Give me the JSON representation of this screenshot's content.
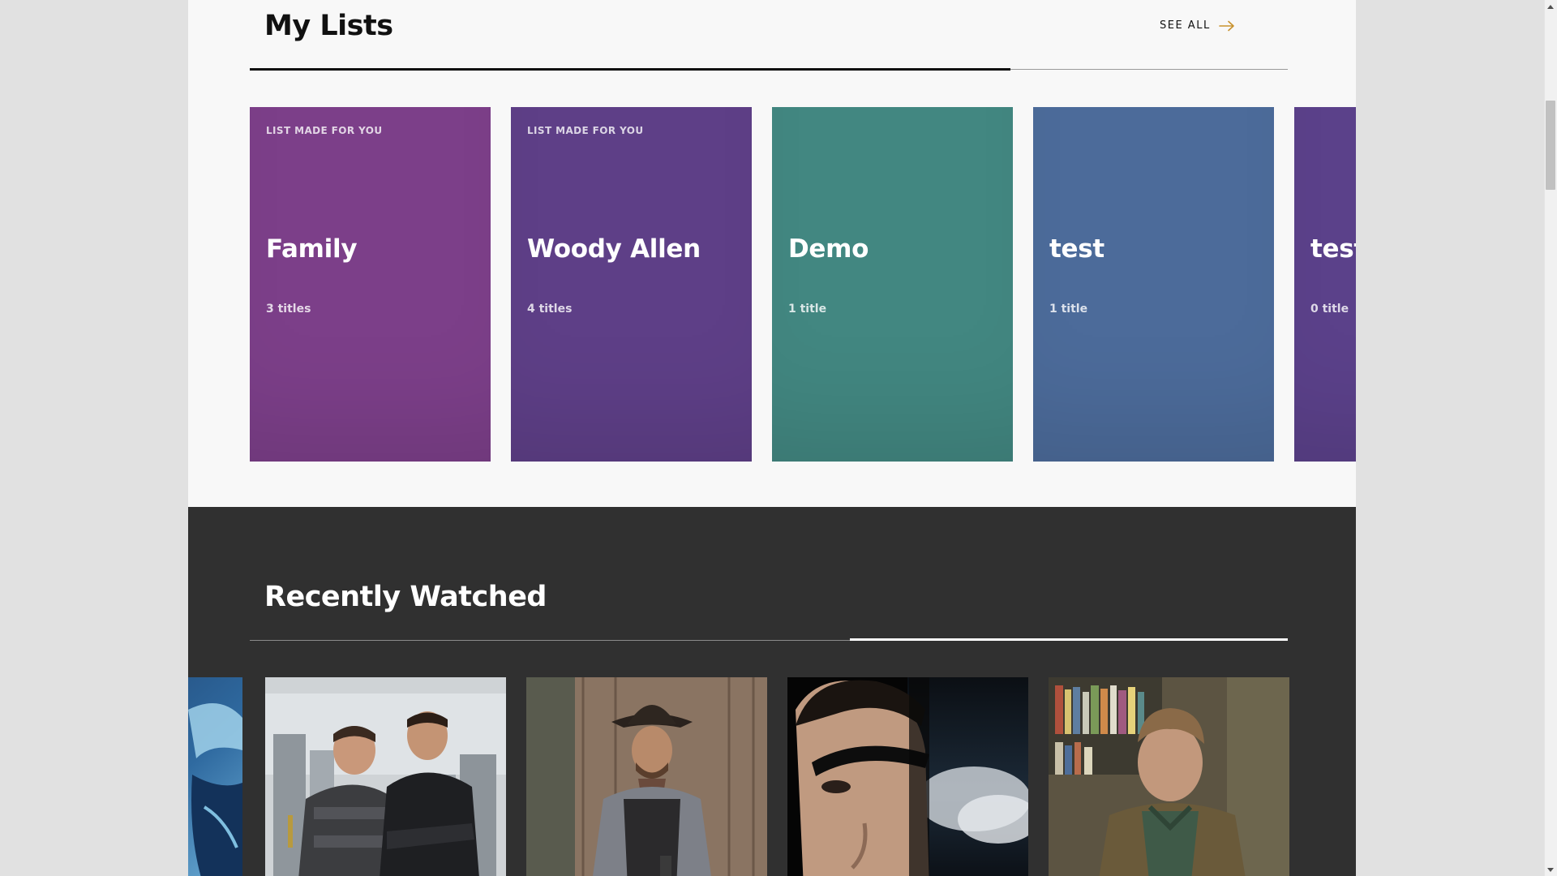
{
  "my_lists": {
    "title": "My Lists",
    "see_all_label": "SEE ALL",
    "accent_color": "#c8922e",
    "cards": [
      {
        "tag": "LIST MADE FOR YOU",
        "name": "Family",
        "count": "3 titles",
        "color": "#7c3f89"
      },
      {
        "tag": "LIST MADE FOR YOU",
        "name": "Woody Allen",
        "count": "4 titles",
        "color": "#5e3f87"
      },
      {
        "tag": "",
        "name": "Demo",
        "count": "1 title",
        "color": "#428781"
      },
      {
        "tag": "",
        "name": "test",
        "count": "1 title",
        "color": "#4c6b9a"
      },
      {
        "tag": "",
        "name": "test",
        "count": "0 title",
        "color": "#5b418a"
      }
    ]
  },
  "recently_watched": {
    "title": "Recently Watched",
    "posters": [
      {
        "icon": "movie-poster-blue-icon"
      },
      {
        "icon": "movie-poster-two-men-city-icon"
      },
      {
        "icon": "movie-poster-cowboy-icon"
      },
      {
        "icon": "movie-poster-eyepatch-icon"
      },
      {
        "icon": "movie-poster-man-bookshelf-icon"
      }
    ]
  }
}
